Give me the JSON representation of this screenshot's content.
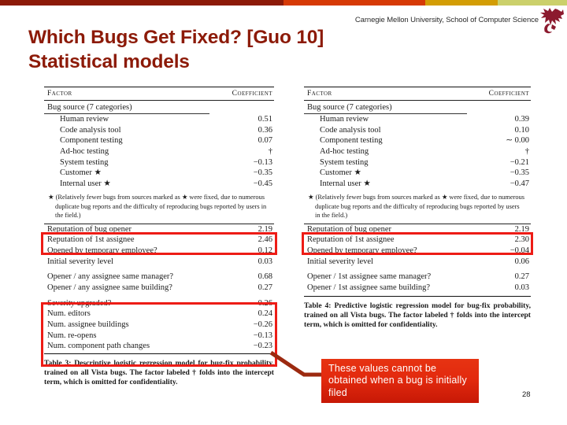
{
  "top_bar": {
    "segments": [
      {
        "name": "dark-red",
        "color": "#8C1A08",
        "width_pct": 50.0
      },
      {
        "name": "orange-red",
        "color": "#D63A06",
        "width_pct": 25.0
      },
      {
        "name": "gold",
        "color": "#D39D04",
        "width_pct": 12.8
      },
      {
        "name": "light-olive",
        "color": "#CBD06B",
        "width_pct": 12.2
      }
    ]
  },
  "header": {
    "institution": "Carnegie Mellon University, School of Computer Science",
    "logo_name": "cmu-scs-griffin-logo",
    "logo_color": "#8C1A2E"
  },
  "title": {
    "line1": "Which Bugs Get Fixed? [Guo 10]",
    "line2": "Statistical models",
    "color": "#8C1A08"
  },
  "tables": {
    "left": {
      "id": "table-3",
      "columns": [
        "Factor",
        "Coefficient"
      ],
      "group_label": "Bug source (7 categories)",
      "bug_source_rows": [
        {
          "factor": "Human review",
          "coefficient": "0.51"
        },
        {
          "factor": "Code analysis tool",
          "coefficient": "0.36"
        },
        {
          "factor": "Component testing",
          "coefficient": "0.07"
        },
        {
          "factor": "Ad-hoc testing",
          "coefficient": "†"
        },
        {
          "factor": "System testing",
          "coefficient": "−0.13"
        },
        {
          "factor": "Customer ★",
          "coefficient": "−0.35"
        },
        {
          "factor": "Internal user ★",
          "coefficient": "−0.45"
        }
      ],
      "footnote": "★ (Relatively fewer bugs from sources marked as ★ were fixed, due to numerous duplicate bug reports and the difficulty of reproducing bugs reported by users in the field.)",
      "group_b_rows": [
        {
          "factor": "Reputation of bug opener",
          "coefficient": "2.19",
          "highlighted": true
        },
        {
          "factor": "Reputation of 1st assignee",
          "coefficient": "2.46",
          "highlighted": true
        },
        {
          "factor": "Opened by temporary employee?",
          "coefficient": "0.12",
          "highlighted": false
        },
        {
          "factor": "Initial severity level",
          "coefficient": "0.03",
          "highlighted": false
        }
      ],
      "group_c_rows": [
        {
          "factor": "Opener / any assignee same manager?",
          "coefficient": "0.68"
        },
        {
          "factor": "Opener / any assignee same building?",
          "coefficient": "0.27"
        }
      ],
      "group_d_rows": [
        {
          "factor": "Severity upgraded?",
          "coefficient": "0.26"
        },
        {
          "factor": "Num. editors",
          "coefficient": "0.24"
        },
        {
          "factor": "Num. assignee buildings",
          "coefficient": "−0.26"
        },
        {
          "factor": "Num. re-opens",
          "coefficient": "−0.13"
        },
        {
          "factor": "Num. component path changes",
          "coefficient": "−0.23"
        }
      ],
      "caption": "Table 3: Descriptive logistic regression model for bug-fix probability, trained on all Vista bugs. The factor labeled † folds into the intercept term, which is omitted for confidentiality."
    },
    "right": {
      "id": "table-4",
      "columns": [
        "Factor",
        "Coefficient"
      ],
      "group_label": "Bug source (7 categories)",
      "bug_source_rows": [
        {
          "factor": "Human review",
          "coefficient": "0.39"
        },
        {
          "factor": "Code analysis tool",
          "coefficient": "0.10"
        },
        {
          "factor": "Component testing",
          "coefficient": "∼ 0.00"
        },
        {
          "factor": "Ad-hoc testing",
          "coefficient": "†"
        },
        {
          "factor": "System testing",
          "coefficient": "−0.21"
        },
        {
          "factor": "Customer ★",
          "coefficient": "−0.35"
        },
        {
          "factor": "Internal user ★",
          "coefficient": "−0.47"
        }
      ],
      "footnote": "★ (Relatively fewer bugs from sources marked as ★ were fixed, due to numerous duplicate bug reports and the difficulty of reproducing bugs reported by users in the field.)",
      "group_b_rows": [
        {
          "factor": "Reputation of bug opener",
          "coefficient": "2.19",
          "highlighted": true
        },
        {
          "factor": "Reputation of 1st assignee",
          "coefficient": "2.30",
          "highlighted": true
        },
        {
          "factor": "Opened by temporary employee?",
          "coefficient": "−0.04",
          "highlighted": false
        },
        {
          "factor": "Initial severity level",
          "coefficient": "0.06",
          "highlighted": false
        }
      ],
      "group_c_rows": [
        {
          "factor": "Opener / 1st assignee same manager?",
          "coefficient": "0.27"
        },
        {
          "factor": "Opener / 1st assignee same building?",
          "coefficient": "0.03"
        }
      ],
      "caption": "Table 4: Predictive logistic regression model for bug-fix probability, trained on all Vista bugs. The factor labeled † folds into the intercept term, which is omitted for confidentiality."
    }
  },
  "annotation": {
    "callout_text": "These values cannot be obtained when a bug is initially filed",
    "callout_bg_start": "#E63312",
    "callout_bg_end": "#C71806",
    "callout_text_color": "#FFFFFF",
    "highlight_color": "#ED1C16",
    "connector_color": "#9C2A10"
  },
  "page_number": "28"
}
